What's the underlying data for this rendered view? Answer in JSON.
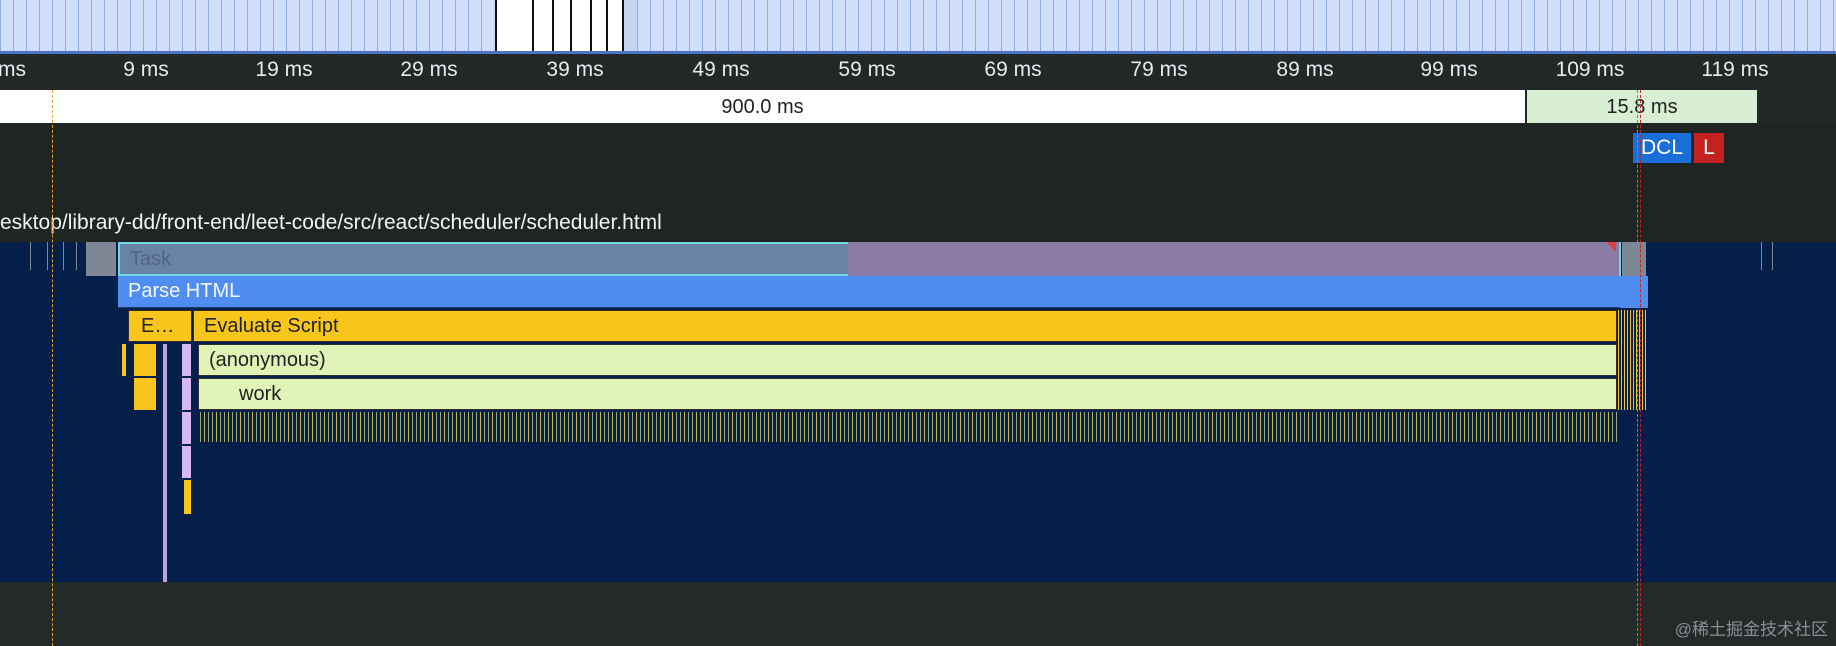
{
  "overview": {
    "bar_color": "#d0defa",
    "accent": "#4b74c8"
  },
  "ruler": {
    "ticks": [
      "ms",
      "9 ms",
      "19 ms",
      "29 ms",
      "39 ms",
      "49 ms",
      "59 ms",
      "69 ms",
      "79 ms",
      "89 ms",
      "99 ms",
      "109 ms",
      "119 ms"
    ]
  },
  "timings": {
    "main_label": "900.0 ms",
    "second_label": "15.8 ms"
  },
  "markers": {
    "dcl": "DCL",
    "load": "L",
    "dcl_color": "#1a6ed8",
    "load_color": "#c5221f"
  },
  "url": "esktop/library-dd/front-end/leet-code/src/react/scheduler/scheduler.html",
  "flame": {
    "task": "Task",
    "parse_html": "Parse HTML",
    "evaluate_short": "E…",
    "evaluate_script": "Evaluate Script",
    "anonymous": "(anonymous)",
    "work": "work"
  },
  "colors": {
    "task": "#6a82a3",
    "parse": "#4f8df1",
    "script": "#f8c51a",
    "js": "#dff4b6",
    "background": "#061e4a"
  },
  "watermark": "@稀土掘金技术社区"
}
